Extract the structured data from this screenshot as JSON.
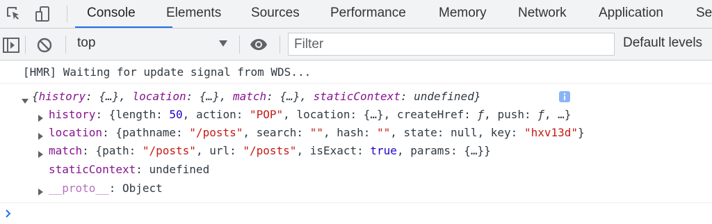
{
  "tabs": [
    {
      "label": "Console",
      "active": true
    },
    {
      "label": "Elements"
    },
    {
      "label": "Sources"
    },
    {
      "label": "Performance"
    },
    {
      "label": "Memory"
    },
    {
      "label": "Network"
    },
    {
      "label": "Application"
    },
    {
      "label": "Se"
    }
  ],
  "toolbar": {
    "context_value": "top",
    "filter_placeholder": "Filter",
    "levels_label": "Default levels"
  },
  "colors": {
    "accent": "#1a73e8",
    "key": "#881391",
    "string": "#c41a16",
    "number": "#1c00cf"
  },
  "console": {
    "log_line": "[HMR] Waiting for update signal from WDS...",
    "object_summary": {
      "open": "{",
      "history_key": "history",
      "history_val": ": {…}, ",
      "location_key": "location",
      "location_val": ": {…}, ",
      "match_key": "match",
      "match_val": ": {…}, ",
      "static_key": "staticContext",
      "static_val": ": undefined",
      "close": "}"
    },
    "history": {
      "key": "history",
      "p1": ": {length: ",
      "length": "50",
      "p2": ", action: ",
      "action": "\"POP\"",
      "p3": ", location: {…}, createHref: ",
      "f1": "ƒ",
      "p4": ", push: ",
      "f2": "ƒ",
      "p5": ", …}"
    },
    "location": {
      "key": "location",
      "p1": ": {pathname: ",
      "pathname": "\"/posts\"",
      "p2": ", search: ",
      "search": "\"\"",
      "p3": ", hash: ",
      "hash": "\"\"",
      "p4": ", state: null, key: ",
      "keyval": "\"hxv13d\"",
      "p5": "}"
    },
    "match": {
      "key": "match",
      "p1": ": {path: ",
      "path": "\"/posts\"",
      "p2": ", url: ",
      "url": "\"/posts\"",
      "p3": ", isExact: ",
      "exact": "true",
      "p4": ", params: {…}}"
    },
    "static": {
      "key": "staticContext",
      "val": ": undefined"
    },
    "proto": {
      "key": "__proto__",
      "val": ": Object"
    }
  }
}
